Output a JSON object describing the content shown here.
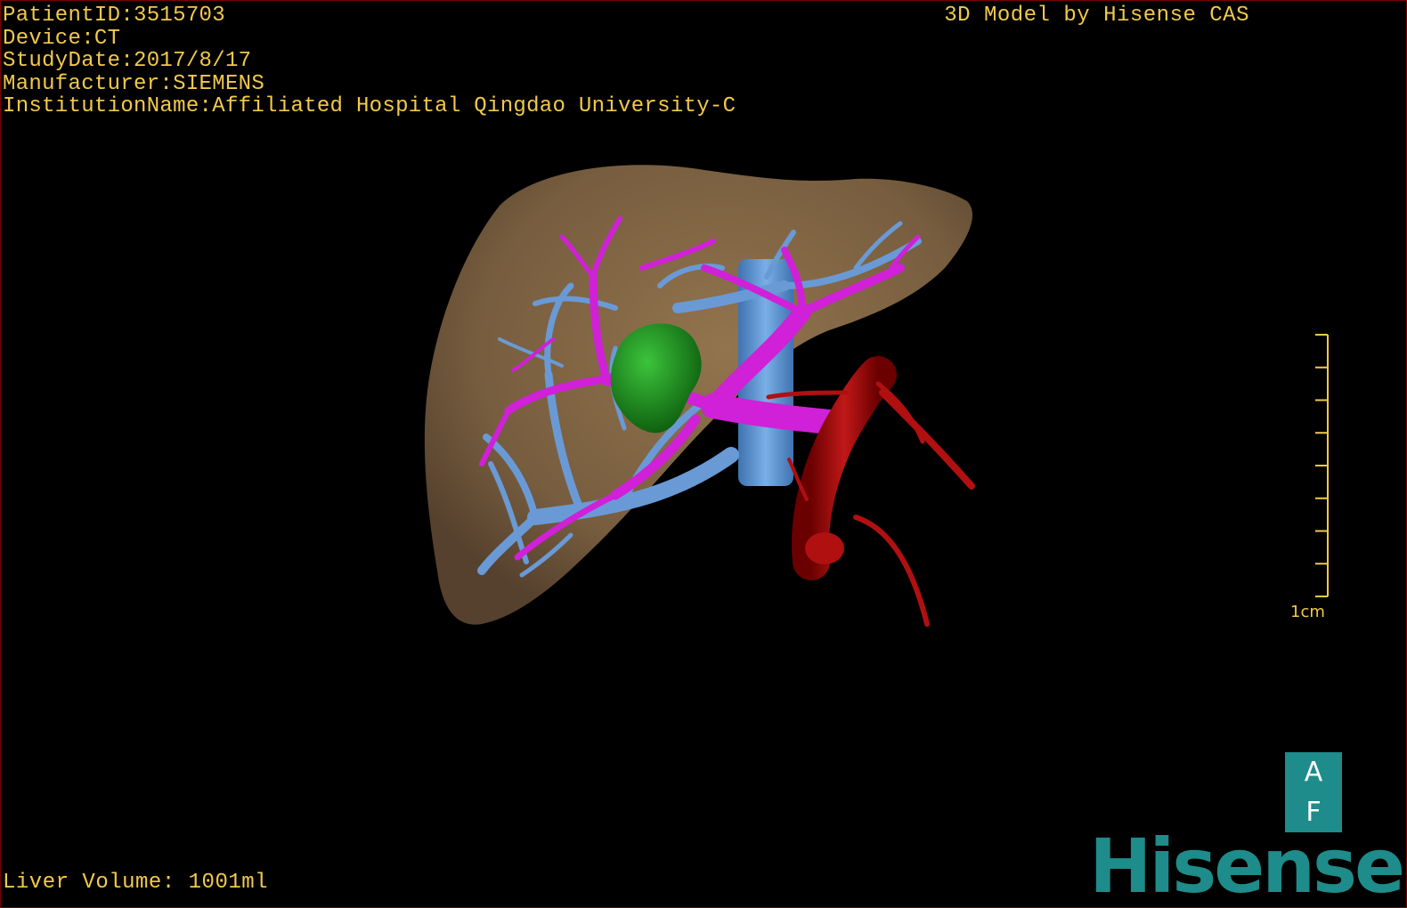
{
  "info": {
    "patient_id": "PatientID:3515703",
    "device": "Device:CT",
    "study_date": "StudyDate:2017/8/17",
    "manufacturer": "Manufacturer:SIEMENS",
    "institution": "InstitutionName:Affiliated Hospital Qingdao University-C"
  },
  "credit": "3D Model by Hisense CAS",
  "liver_volume": "Liver Volume: 1001ml",
  "scale": {
    "label": "1cm",
    "tick_count": 9
  },
  "orientation": {
    "top": "A",
    "bottom": "F"
  },
  "brand": "Hisense",
  "colors": {
    "overlay_text": "#f2c94c",
    "liver": "#8a6d4a",
    "portal_vein": "#d000d0",
    "hepatic_vein": "#5a8fd0",
    "artery": "#a00000",
    "lesion": "#1a8a1a",
    "brand": "#1e8c8a"
  }
}
